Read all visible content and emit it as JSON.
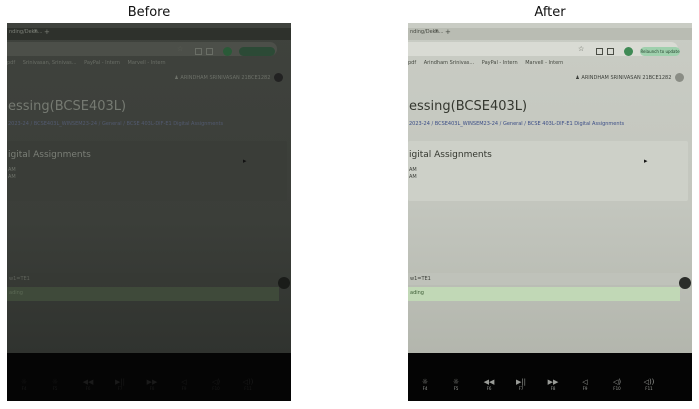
{
  "panels": [
    {
      "title": "Before",
      "tab_label": "nding/Dekh...",
      "bookmarks": [
        "pdf",
        "Srinivasan, Srinivas...",
        "PayPal - Intern",
        "Marvell - Intern"
      ],
      "relaunch": "",
      "profile_name": "ARINDHAM SRINIVASAN 21BCE1282",
      "course_title": "essing(BCSE403L)",
      "breadcrumb": "2023-24 / BCSE403L_WINSEM23-24 / General / BCSE 403L-DIF-E1 Digital Assignments",
      "section_title": "igital Assignments",
      "date_line_1": "AM",
      "date_line_2": "AM",
      "status_1": "w1=TE1",
      "status_2": "ading",
      "colors": {
        "screen": "#3d403b",
        "text": "#8d9188",
        "accent": "#4a7a4a",
        "status": "#3f4a3a"
      }
    },
    {
      "title": "After",
      "tab_label": "nding/Dekh...",
      "bookmarks": [
        "pdf",
        "Arindham Srinivas...",
        "PayPal - Intern",
        "Marvell - Intern"
      ],
      "relaunch": "Relaunch to update",
      "profile_name": "ARINDHAM SRINIVASAN 21BCE1282",
      "course_title": "essing(BCSE403L)",
      "breadcrumb": "2023-24 / BCSE403L_WINSEM23-24 / General / BCSE 403L-DIF-E1 Digital Assignments",
      "section_title": "igital Assignments",
      "date_line_1": "AM",
      "date_line_2": "AM",
      "status_1": "w1=TE1",
      "status_2": "ading",
      "colors": {
        "screen": "#c6c9c1",
        "text": "#3c3f3a",
        "accent": "#5aa36a",
        "status": "#c1d8b6"
      }
    }
  ],
  "keys": [
    {
      "glyph": "☼",
      "fn": "F4"
    },
    {
      "glyph": "☼",
      "fn": "F5"
    },
    {
      "glyph": "◀◀",
      "fn": "F6"
    },
    {
      "glyph": "▶||",
      "fn": "F7"
    },
    {
      "glyph": "▶▶",
      "fn": "F8"
    },
    {
      "glyph": "◁",
      "fn": "F9"
    },
    {
      "glyph": "◁)",
      "fn": "F10"
    },
    {
      "glyph": "◁))",
      "fn": "F11"
    }
  ]
}
